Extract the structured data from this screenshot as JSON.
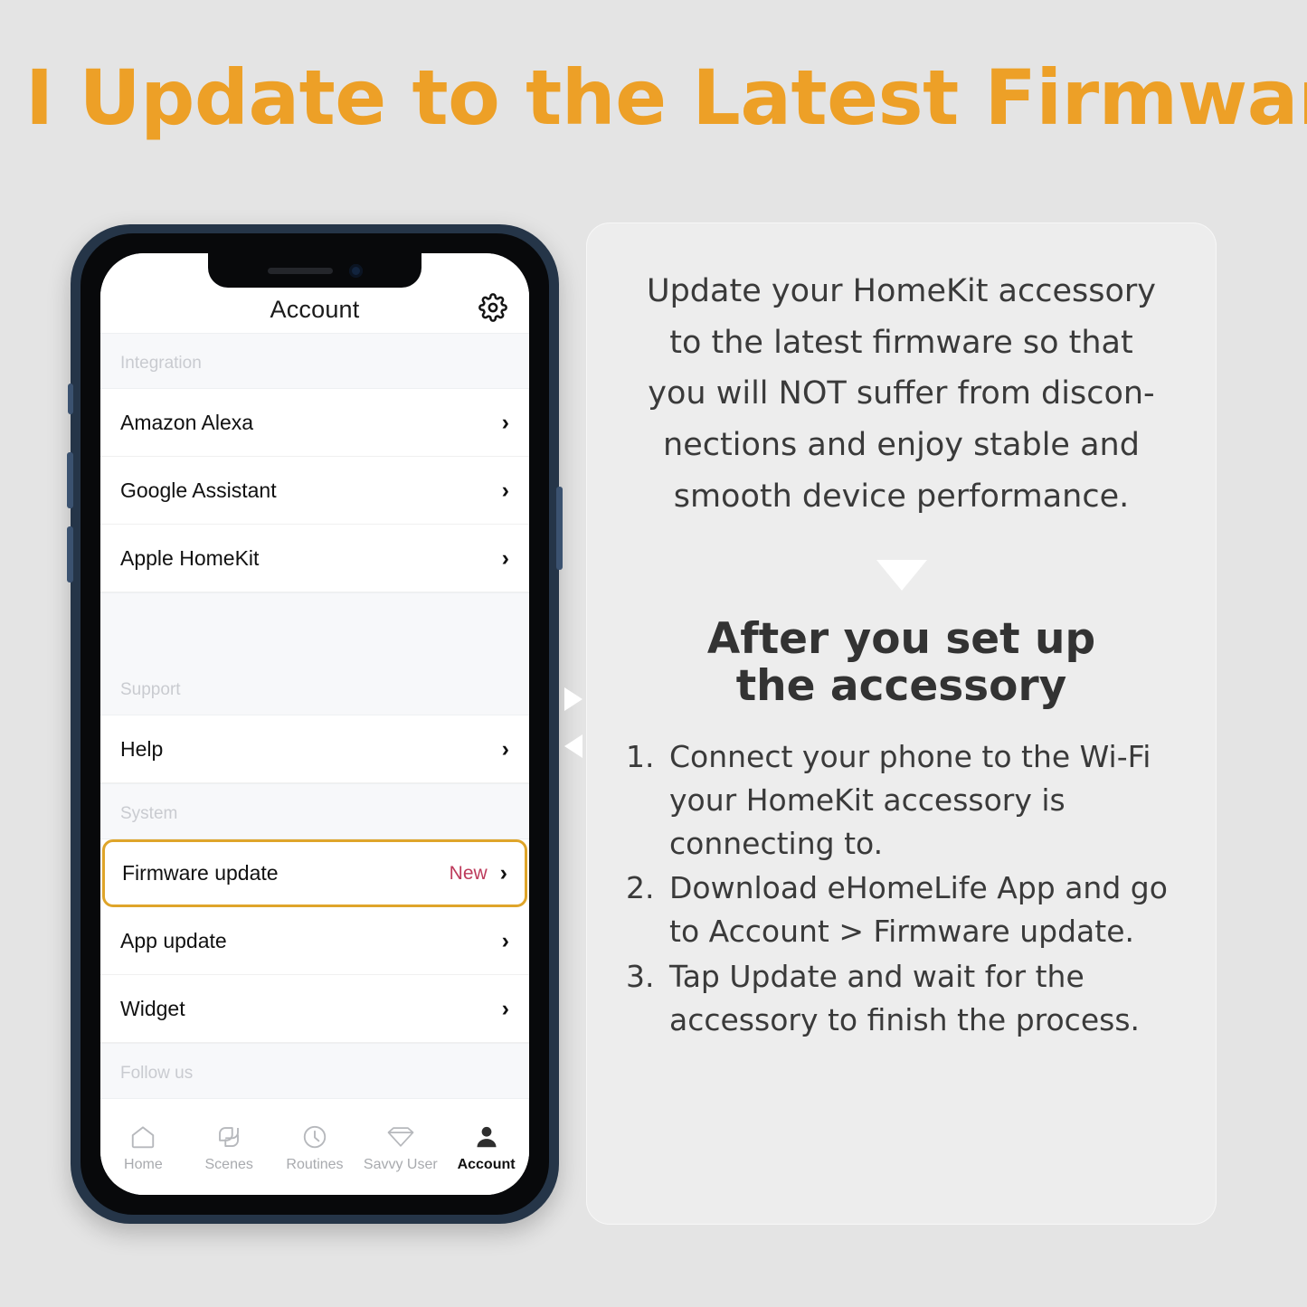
{
  "page": {
    "title": "I Update to the Latest Firmware",
    "title_color": "#eda027",
    "background_color": "#e4e4e4"
  },
  "phone": {
    "frame_color": "#253548",
    "app": {
      "header": {
        "title": "Account",
        "settings_icon": "gear-icon"
      },
      "sections": [
        {
          "heading": "Integration",
          "tall_gap": false,
          "rows": [
            {
              "label": "Amazon Alexa",
              "badge": "",
              "chevron": "›",
              "highlighted": false
            },
            {
              "label": "Google Assistant",
              "badge": "",
              "chevron": "›",
              "highlighted": false
            },
            {
              "label": "Apple HomeKit",
              "badge": "",
              "chevron": "›",
              "highlighted": false
            }
          ]
        },
        {
          "heading": "Support",
          "tall_gap": true,
          "rows": [
            {
              "label": "Help",
              "badge": "",
              "chevron": "›",
              "highlighted": false
            }
          ]
        },
        {
          "heading": "System",
          "tall_gap": false,
          "rows": [
            {
              "label": "Firmware update",
              "badge": "New",
              "chevron": "›",
              "highlighted": true
            },
            {
              "label": "App update",
              "badge": "",
              "chevron": "›",
              "highlighted": false
            },
            {
              "label": "Widget",
              "badge": "",
              "chevron": "›",
              "highlighted": false
            }
          ]
        },
        {
          "heading": "Follow us",
          "tall_gap": false,
          "rows": []
        }
      ],
      "badge_color": "#bd3a5b",
      "highlight_border_color": "#dfa52a",
      "tabbar": [
        {
          "label": "Home",
          "icon": "home-icon",
          "active": false
        },
        {
          "label": "Scenes",
          "icon": "scenes-icon",
          "active": false
        },
        {
          "label": "Routines",
          "icon": "clock-icon",
          "active": false
        },
        {
          "label": "Savvy User",
          "icon": "diamond-icon",
          "active": false
        },
        {
          "label": "Account",
          "icon": "person-icon",
          "active": true
        }
      ]
    }
  },
  "panel": {
    "intro": "Update your HomeKit accessory to the latest firmware so that you will NOT suffer from discon-nections and enjoy stable and smooth device performance.",
    "intro_lines": [
      "Update your HomeKit accessory",
      "to the latest firmware so that",
      "you will NOT suffer from discon-",
      "nections and enjoy stable and",
      "smooth device performance."
    ],
    "divider_icon": "triangle-down-icon",
    "heading_lines": [
      "After you set up",
      "the accessory"
    ],
    "steps": [
      {
        "number": "1.",
        "text": "Connect your phone to the Wi-Fi your HomeKit accessory is connecting to."
      },
      {
        "number": "2.",
        "text": "Download eHomeLife App and go to Account > Firmware update."
      },
      {
        "number": "3.",
        "text": "Tap Update and wait for the accessory to finish the process."
      }
    ]
  }
}
